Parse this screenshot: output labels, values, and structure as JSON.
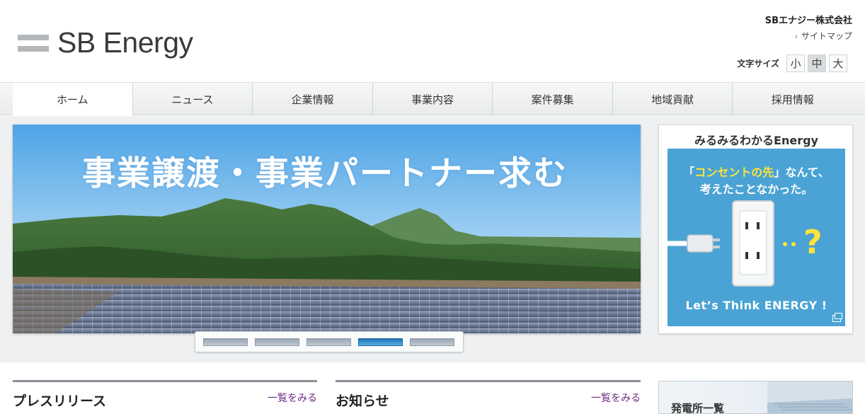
{
  "header": {
    "logo_text": "SB Energy",
    "company_name": "SBエナジー株式会社",
    "sitemap_label": "サイトマップ",
    "font_size": {
      "label": "文字サイズ",
      "options": [
        "小",
        "中",
        "大"
      ],
      "selected": "中"
    }
  },
  "nav": {
    "items": [
      "ホーム",
      "ニュース",
      "企業情報",
      "事業内容",
      "案件募集",
      "地域貢献",
      "採用情報"
    ],
    "active": "ホーム"
  },
  "hero": {
    "title": "事業譲渡・事業パートナー求む",
    "slides_total": 5,
    "active_slide": 4
  },
  "side": {
    "title": "みるみるわかるEnergy",
    "banner": {
      "line1_prefix": "「",
      "line1_highlight": "コンセントの先",
      "line1_suffix": "」なんて、",
      "line2": "考えたことなかった。",
      "footer": "Let’s Think ENERGY !"
    }
  },
  "sections": {
    "press": {
      "title": "プレスリリース",
      "more": "一覧をみる"
    },
    "news": {
      "title": "お知らせ",
      "more": "一覧をみる"
    },
    "plant": {
      "title": "発電所一覧"
    }
  },
  "colors": {
    "accent_blue": "#4aa3d4",
    "highlight_yellow": "#ffe43a",
    "link_purple": "#6b2a82",
    "pager_active": "#1e75b8"
  }
}
